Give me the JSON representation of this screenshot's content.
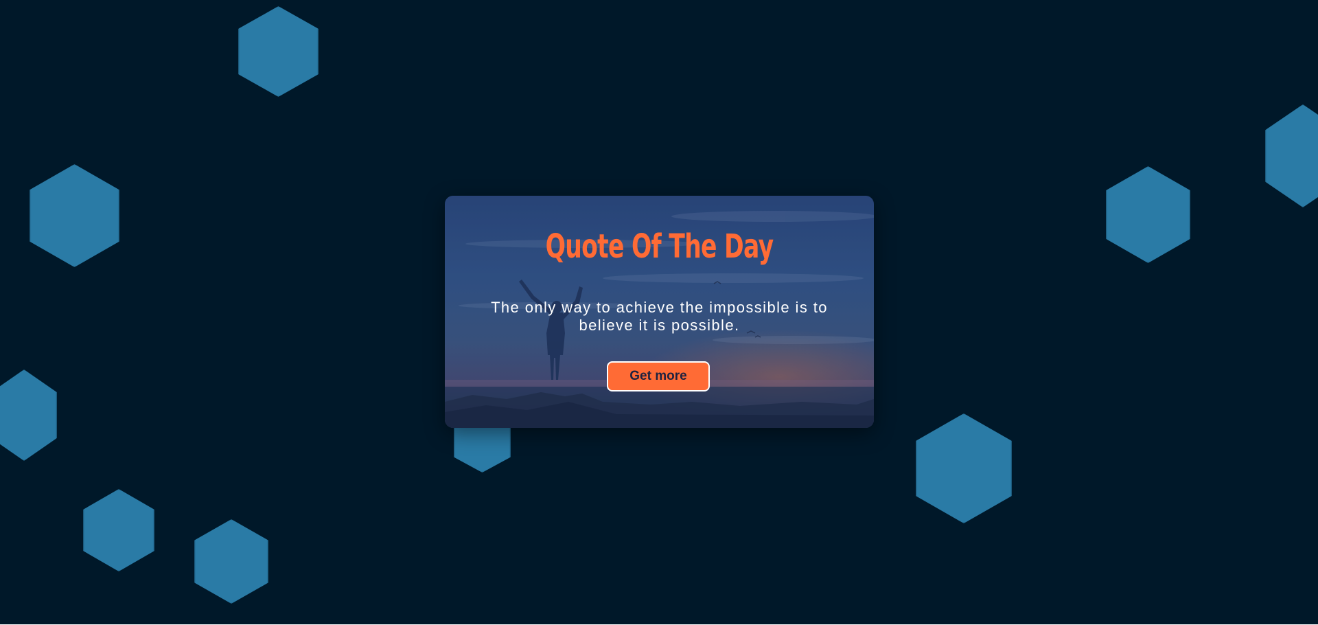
{
  "page": {
    "background_color": "#001829",
    "shape_color": "#2a7ba6"
  },
  "card": {
    "title": "Quote Of The Day",
    "quote": "The only way to achieve the impossible is to believe it is possible.",
    "button_label": "Get more",
    "accent_color": "#ff6b35",
    "background_image": "silhouette-raised-arms-sunset-image"
  }
}
